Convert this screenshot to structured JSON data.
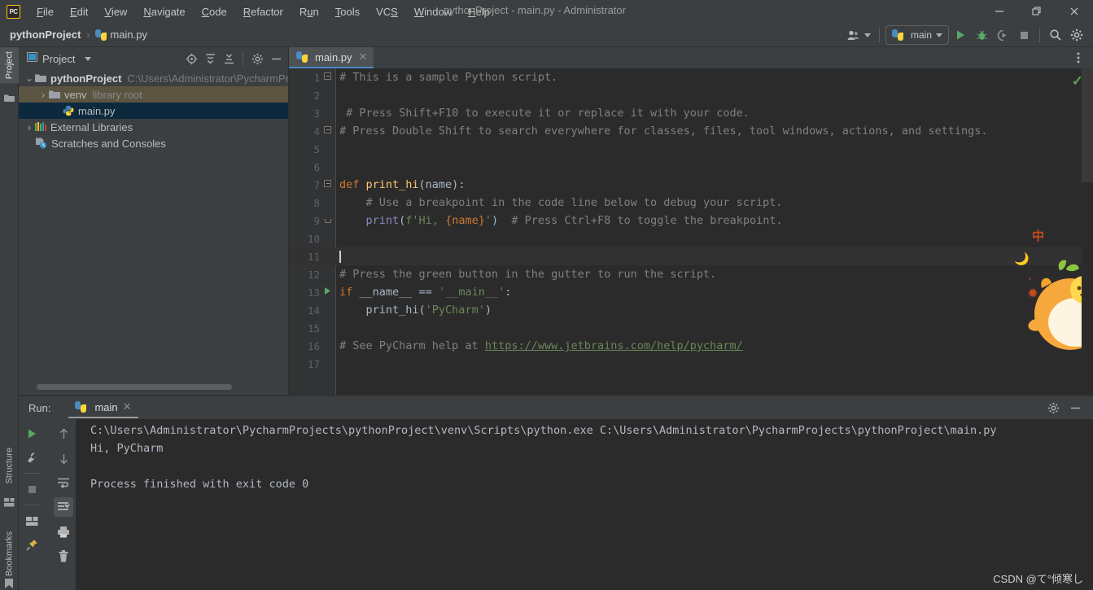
{
  "window": {
    "title": "pythonProject - main.py - Administrator",
    "logo_text": "PC",
    "controls": [
      {
        "name": "minimize",
        "glyph": "—"
      },
      {
        "name": "maximize",
        "glyph": "❐"
      },
      {
        "name": "close",
        "glyph": "✕"
      }
    ]
  },
  "menubar": [
    {
      "label": "File",
      "mnemonic": "F"
    },
    {
      "label": "Edit",
      "mnemonic": "E"
    },
    {
      "label": "View",
      "mnemonic": "V"
    },
    {
      "label": "Navigate",
      "mnemonic": "N"
    },
    {
      "label": "Code",
      "mnemonic": "C"
    },
    {
      "label": "Refactor",
      "mnemonic": "R"
    },
    {
      "label": "Run",
      "mnemonic": "u"
    },
    {
      "label": "Tools",
      "mnemonic": "T"
    },
    {
      "label": "VCS",
      "mnemonic": "S"
    },
    {
      "label": "Window",
      "mnemonic": "W"
    },
    {
      "label": "Help",
      "mnemonic": "H"
    }
  ],
  "navbar": {
    "breadcrumbs": [
      {
        "label": "pythonProject",
        "icon": "none"
      },
      {
        "label": "main.py",
        "icon": "python-file-icon"
      }
    ],
    "separator": "›",
    "toolbar": {
      "account_icon": "user-account-icon",
      "run_config": {
        "label": "main",
        "icon": "python-icon"
      },
      "run_button": "run-icon",
      "debug_button": "debug-bug-icon",
      "coverage_button": "run-with-coverage-icon",
      "stop_button": "stop-icon",
      "search_button": "search-icon",
      "settings_button": "gear-icon"
    }
  },
  "left_strip": {
    "tabs": [
      {
        "label": "Project",
        "icon": "folder-icon",
        "active": true
      },
      {
        "label": "Structure",
        "icon": "structure-icon",
        "active": false
      },
      {
        "label": "Bookmarks",
        "icon": "bookmark-icon",
        "active": false
      }
    ]
  },
  "project_panel": {
    "title": "Project",
    "dropdown_caret": "▾",
    "tools": [
      {
        "name": "select-opened-file-icon",
        "glyph": "⊕"
      },
      {
        "name": "expand-all-icon",
        "glyph": "⨇"
      },
      {
        "name": "collapse-all-icon",
        "glyph": "⨆"
      },
      {
        "name": "gear-icon",
        "glyph": "⚙"
      },
      {
        "name": "hide-icon",
        "glyph": "—"
      }
    ],
    "tree": [
      {
        "label": "pythonProject",
        "suffix": "C:\\Users\\Administrator\\PycharmPr",
        "arrow": "∨",
        "icon": "folder-icon",
        "depth": 0,
        "bold": true,
        "state": "normal"
      },
      {
        "label": "venv",
        "suffix": "library root",
        "arrow": "›",
        "icon": "folder-icon",
        "depth": 1,
        "bold": false,
        "state": "venv-highlight"
      },
      {
        "label": "main.py",
        "suffix": "",
        "arrow": "",
        "icon": "python-file-icon",
        "depth": 2,
        "bold": false,
        "state": "selected"
      },
      {
        "label": "External Libraries",
        "suffix": "",
        "arrow": "›",
        "icon": "external-libraries-icon",
        "depth": 0,
        "bold": false,
        "state": "normal"
      },
      {
        "label": "Scratches and Consoles",
        "suffix": "",
        "arrow": "",
        "icon": "scratches-icon",
        "depth": 0,
        "bold": false,
        "state": "normal"
      }
    ]
  },
  "editor": {
    "tab": {
      "label": "main.py",
      "icon": "python-file-icon",
      "close": "✕"
    },
    "more_icon": "vertical-dots-icon",
    "inspection_status": "✓",
    "lines": [
      {
        "n": "1",
        "gutter": "fold-open",
        "tokens": [
          {
            "t": "# This is a sample Python script.",
            "c": "cmt"
          }
        ]
      },
      {
        "n": "2",
        "gutter": "",
        "tokens": []
      },
      {
        "n": "3",
        "gutter": "",
        "tokens": [
          {
            "t": " # Press Shift+F10 to execute it or replace it with your code.",
            "c": "cmt"
          }
        ]
      },
      {
        "n": "4",
        "gutter": "fold-close",
        "tokens": [
          {
            "t": "# Press Double Shift to search everywhere for classes, files, tool windows, actions, and settings.",
            "c": "cmt"
          }
        ]
      },
      {
        "n": "5",
        "gutter": "",
        "tokens": []
      },
      {
        "n": "6",
        "gutter": "",
        "tokens": []
      },
      {
        "n": "7",
        "gutter": "fold-open",
        "tokens": [
          {
            "t": "def ",
            "c": "kw"
          },
          {
            "t": "print_hi",
            "c": "fn"
          },
          {
            "t": "(name):",
            "c": "var"
          }
        ]
      },
      {
        "n": "8",
        "gutter": "",
        "tokens": [
          {
            "t": "    # Use a breakpoint in the code line below to debug your script.",
            "c": "cmt"
          }
        ]
      },
      {
        "n": "9",
        "gutter": "fold-end",
        "tokens": [
          {
            "t": "    ",
            "c": "var"
          },
          {
            "t": "print",
            "c": "bi"
          },
          {
            "t": "(",
            "c": "var"
          },
          {
            "t": "f'Hi, ",
            "c": "str"
          },
          {
            "t": "{name}",
            "c": "fstr-br"
          },
          {
            "t": "'",
            "c": "str"
          },
          {
            "t": ")",
            "c": "var"
          },
          {
            "t": "  # Press Ctrl+F8 to toggle the breakpoint.",
            "c": "cmt"
          }
        ]
      },
      {
        "n": "10",
        "gutter": "",
        "tokens": []
      },
      {
        "n": "11",
        "gutter": "",
        "tokens": [],
        "current": true,
        "caret": true
      },
      {
        "n": "12",
        "gutter": "",
        "tokens": [
          {
            "t": "# Press the green button in the gutter to run the script.",
            "c": "cmt"
          }
        ]
      },
      {
        "n": "13",
        "gutter": "run-arrow",
        "tokens": [
          {
            "t": "if ",
            "c": "kw"
          },
          {
            "t": "__name__ ",
            "c": "var"
          },
          {
            "t": "== ",
            "c": "var"
          },
          {
            "t": "'__main__'",
            "c": "str"
          },
          {
            "t": ":",
            "c": "var"
          }
        ]
      },
      {
        "n": "14",
        "gutter": "",
        "tokens": [
          {
            "t": "    print_hi(",
            "c": "var"
          },
          {
            "t": "'PyCharm'",
            "c": "str"
          },
          {
            "t": ")",
            "c": "var"
          }
        ]
      },
      {
        "n": "15",
        "gutter": "",
        "tokens": []
      },
      {
        "n": "16",
        "gutter": "",
        "tokens": [
          {
            "t": "# See PyCharm help at ",
            "c": "cmt"
          },
          {
            "t": "https://www.jetbrains.com/help/pycharm/",
            "c": "lnk"
          }
        ]
      },
      {
        "n": "17",
        "gutter": "",
        "tokens": []
      }
    ],
    "decorations": {
      "cn_char": "中",
      "gear": "✹",
      "comma": ","
    }
  },
  "run_panel": {
    "label": "Run:",
    "tab": {
      "label": "main",
      "icon": "python-icon",
      "close": "✕"
    },
    "right_tools": [
      {
        "name": "gear-icon",
        "glyph": "⚙"
      },
      {
        "name": "hide-icon",
        "glyph": "—"
      }
    ],
    "left_tools": [
      {
        "name": "rerun-icon",
        "glyph": "▶"
      },
      {
        "name": "modify-run-config-icon",
        "glyph": "ὒ7"
      },
      {
        "name": "stop-icon",
        "glyph": "■"
      },
      {
        "name": "restore-layout-icon",
        "glyph": "▤"
      },
      {
        "name": "pin-tab-icon",
        "glyph": "✐"
      }
    ],
    "console_tools": [
      {
        "name": "up-arrow-icon",
        "glyph": "↑"
      },
      {
        "name": "down-arrow-icon",
        "glyph": "↓"
      },
      {
        "name": "soft-wrap-icon",
        "glyph": "↩"
      },
      {
        "name": "scroll-to-end-icon",
        "glyph": "↧"
      },
      {
        "name": "print-icon",
        "glyph": "⎙"
      },
      {
        "name": "clear-all-icon",
        "glyph": "Ὕ1"
      }
    ],
    "console_lines": [
      "C:\\Users\\Administrator\\PycharmProjects\\pythonProject\\venv\\Scripts\\python.exe C:\\Users\\Administrator\\PycharmProjects\\pythonProject\\main.py",
      "Hi, PyCharm",
      "",
      "Process finished with exit code 0"
    ]
  },
  "watermark": "CSDN @て°倾寒し",
  "colors": {
    "accent_blue": "#4a88c7",
    "selection_blue": "#0d293e",
    "venv_highlight": "#5a5441",
    "editor_bg": "#2b2b2b",
    "panel_bg": "#3c3f41",
    "gutter_bg": "#313335",
    "keyword_orange": "#cc7832",
    "string_green": "#6a8759",
    "function_yellow": "#ffc66d",
    "comment_gray": "#808080",
    "builtin_purple": "#8888c6",
    "default_text": "#a9b7c6",
    "run_green": "#59a869",
    "mascot_orange": "#f5a22d"
  }
}
